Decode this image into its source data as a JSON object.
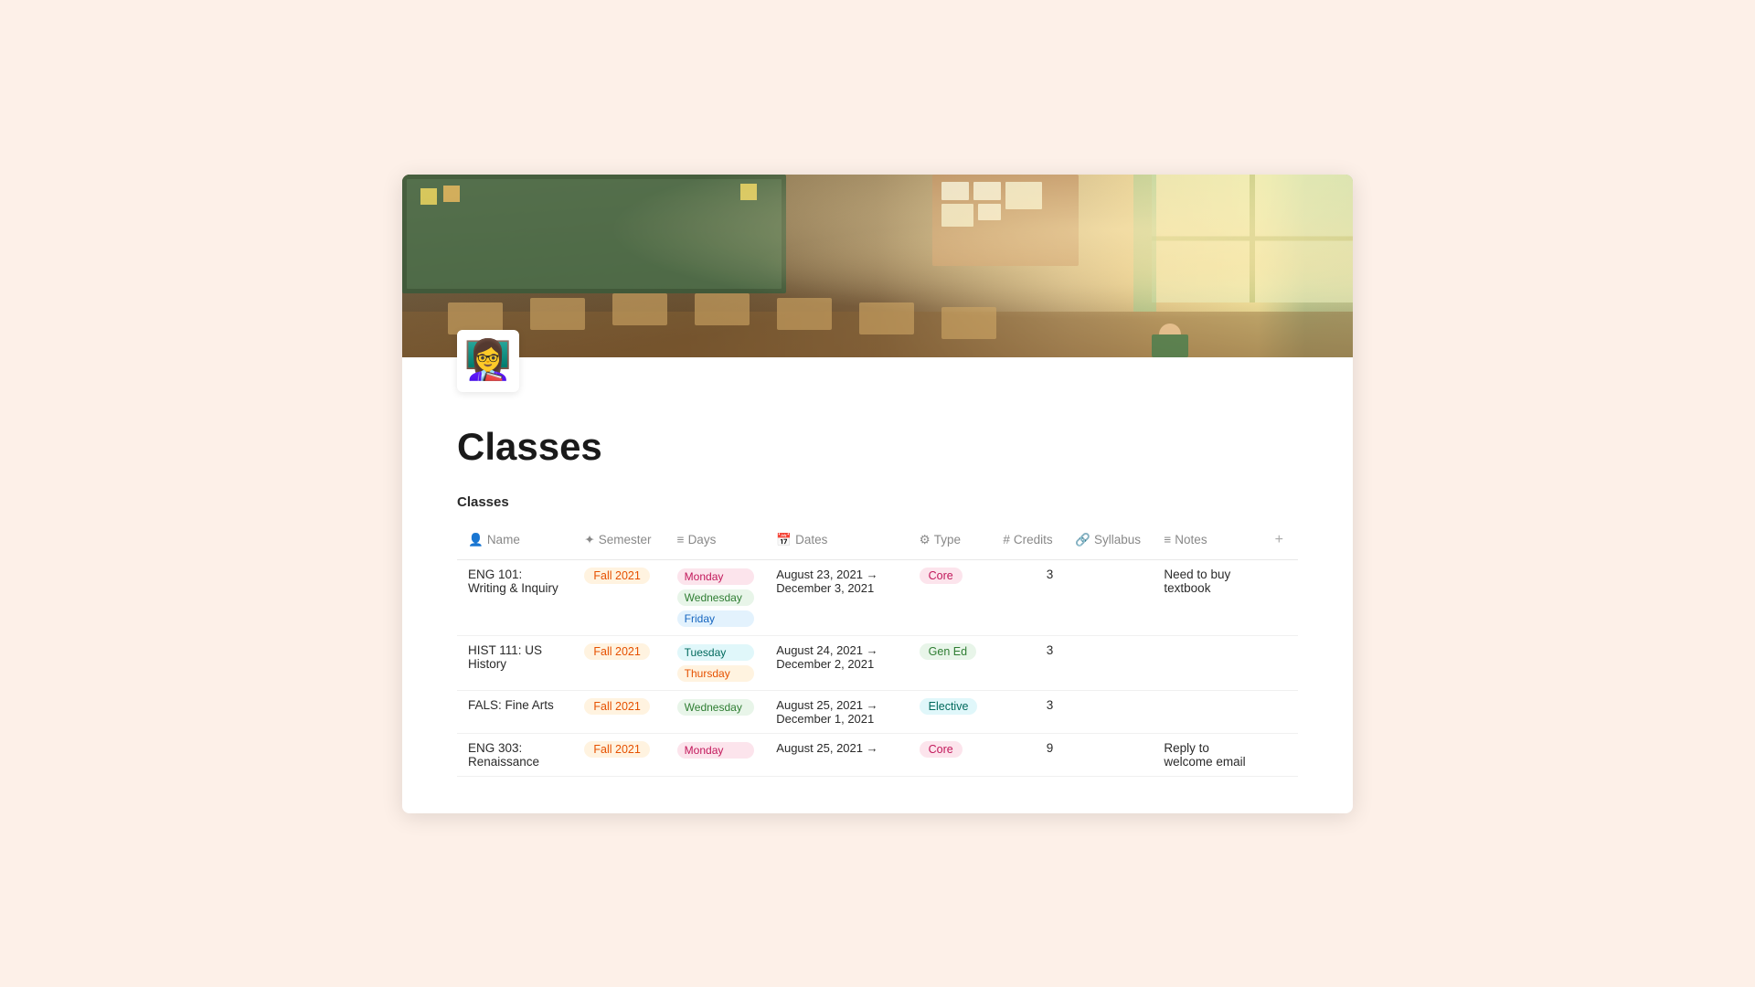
{
  "page": {
    "title": "Classes",
    "avatar_emoji": "👩‍🏫",
    "section_label": "Classes"
  },
  "table": {
    "columns": [
      {
        "id": "name",
        "label": "Name",
        "icon": "person-icon"
      },
      {
        "id": "semester",
        "label": "Semester",
        "icon": "star-icon"
      },
      {
        "id": "days",
        "label": "Days",
        "icon": "list-icon"
      },
      {
        "id": "dates",
        "label": "Dates",
        "icon": "calendar-icon"
      },
      {
        "id": "type",
        "label": "Type",
        "icon": "gear-icon"
      },
      {
        "id": "credits",
        "label": "Credits",
        "icon": "hash-icon"
      },
      {
        "id": "syllabus",
        "label": "Syllabus",
        "icon": "link-icon"
      },
      {
        "id": "notes",
        "label": "Notes",
        "icon": "lines-icon"
      }
    ],
    "rows": [
      {
        "name": "ENG 101: Writing & Inquiry",
        "semester": "Fall 2021",
        "semester_style": "tag-orange",
        "days": [
          "Monday",
          "Wednesday",
          "Friday"
        ],
        "day_styles": [
          "day-monday",
          "day-wednesday",
          "day-friday"
        ],
        "date_start": "August 23, 2021 →",
        "date_end": "December 3, 2021",
        "type": "Core",
        "type_style": "tag-pink",
        "credits": "3",
        "syllabus": "",
        "notes": "Need to buy textbook"
      },
      {
        "name": "HIST 111: US History",
        "semester": "Fall 2021",
        "semester_style": "tag-orange",
        "days": [
          "Tuesday",
          "Thursday"
        ],
        "day_styles": [
          "day-tuesday",
          "day-thursday"
        ],
        "date_start": "August 24, 2021 →",
        "date_end": "December 2, 2021",
        "type": "Gen Ed",
        "type_style": "tag-green",
        "credits": "3",
        "syllabus": "",
        "notes": ""
      },
      {
        "name": "FALS: Fine Arts",
        "semester": "Fall 2021",
        "semester_style": "tag-orange",
        "days": [
          "Wednesday"
        ],
        "day_styles": [
          "day-wednesday"
        ],
        "date_start": "August 25, 2021 →",
        "date_end": "December 1, 2021",
        "type": "Elective",
        "type_style": "tag-teal",
        "credits": "3",
        "syllabus": "",
        "notes": ""
      },
      {
        "name": "ENG 303: Renaissance",
        "semester": "Fall 2021",
        "semester_style": "tag-orange",
        "days": [
          "Monday"
        ],
        "day_styles": [
          "day-monday"
        ],
        "date_start": "August 25, 2021 →",
        "date_end": "",
        "type": "Core",
        "type_style": "tag-pink",
        "credits": "9",
        "syllabus": "",
        "notes": "Reply to welcome email"
      }
    ],
    "add_button_label": "+"
  }
}
